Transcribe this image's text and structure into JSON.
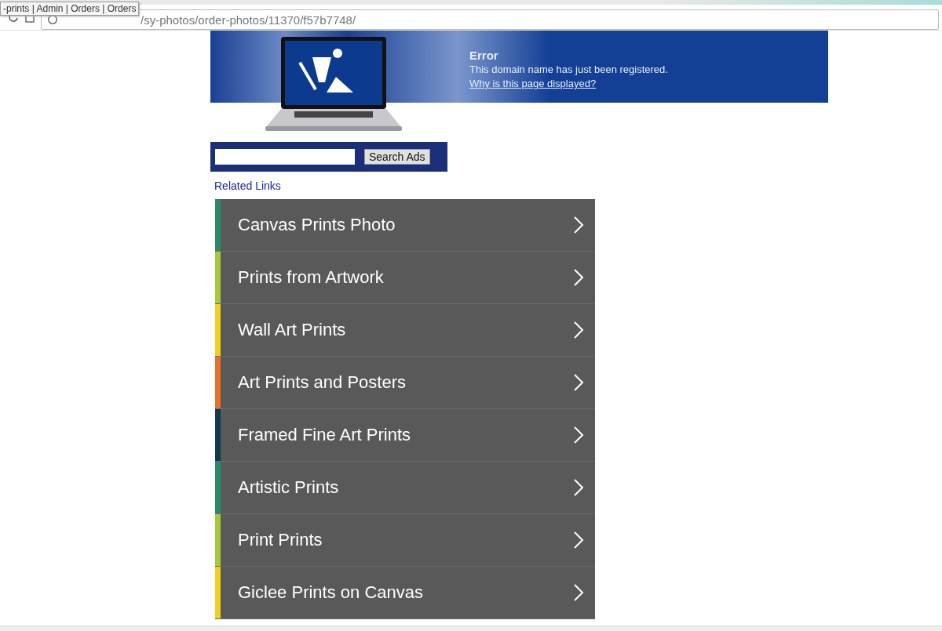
{
  "browser": {
    "tooltip": "-prints | Admin | Orders | Orders",
    "url": "/sy-photos/order-photos/11370/f57b7748/"
  },
  "banner": {
    "title": "Error",
    "message": "This domain name has just been registered.",
    "link": "Why is this page displayed?"
  },
  "search": {
    "button": "Search Ads"
  },
  "related_links": {
    "heading": "Related Links",
    "items": [
      {
        "label": "Canvas Prints Photo",
        "color": "#2a8a6e"
      },
      {
        "label": "Prints from Artwork",
        "color": "#a8c83a"
      },
      {
        "label": "Wall Art Prints",
        "color": "#f0d020"
      },
      {
        "label": "Art Prints and Posters",
        "color": "#e8702a"
      },
      {
        "label": "Framed Fine Art Prints",
        "color": "#0e3a4a"
      },
      {
        "label": "Artistic Prints",
        "color": "#2a8a6e"
      },
      {
        "label": "Print Prints",
        "color": "#a8c83a"
      },
      {
        "label": "Giclee Prints on Canvas",
        "color": "#f0d020"
      }
    ]
  }
}
